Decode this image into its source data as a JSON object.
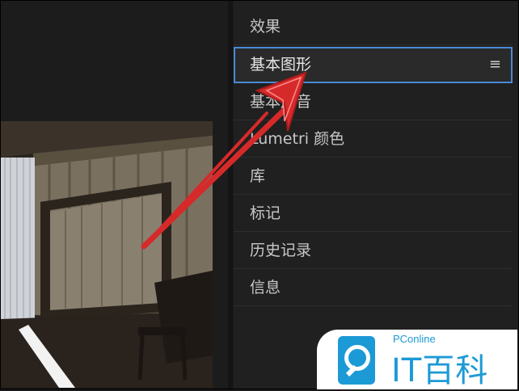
{
  "panel": {
    "items": [
      {
        "label": "效果"
      },
      {
        "label": "基本图形",
        "selected": true,
        "menu_icon": "≡"
      },
      {
        "label": "基本声音"
      },
      {
        "label": "Lumetri 颜色"
      },
      {
        "label": "库"
      },
      {
        "label": "标记"
      },
      {
        "label": "历史记录"
      },
      {
        "label": "信息"
      }
    ]
  },
  "watermark": {
    "small": "PConline",
    "big": "IT百科",
    "icon": "search-magnifier-icon",
    "color": "#1c9ad6"
  },
  "annotation": {
    "arrow_color": "#d62a2a"
  },
  "colors": {
    "selected_border": "#4a8ad6",
    "panel_bg": "#202020"
  }
}
